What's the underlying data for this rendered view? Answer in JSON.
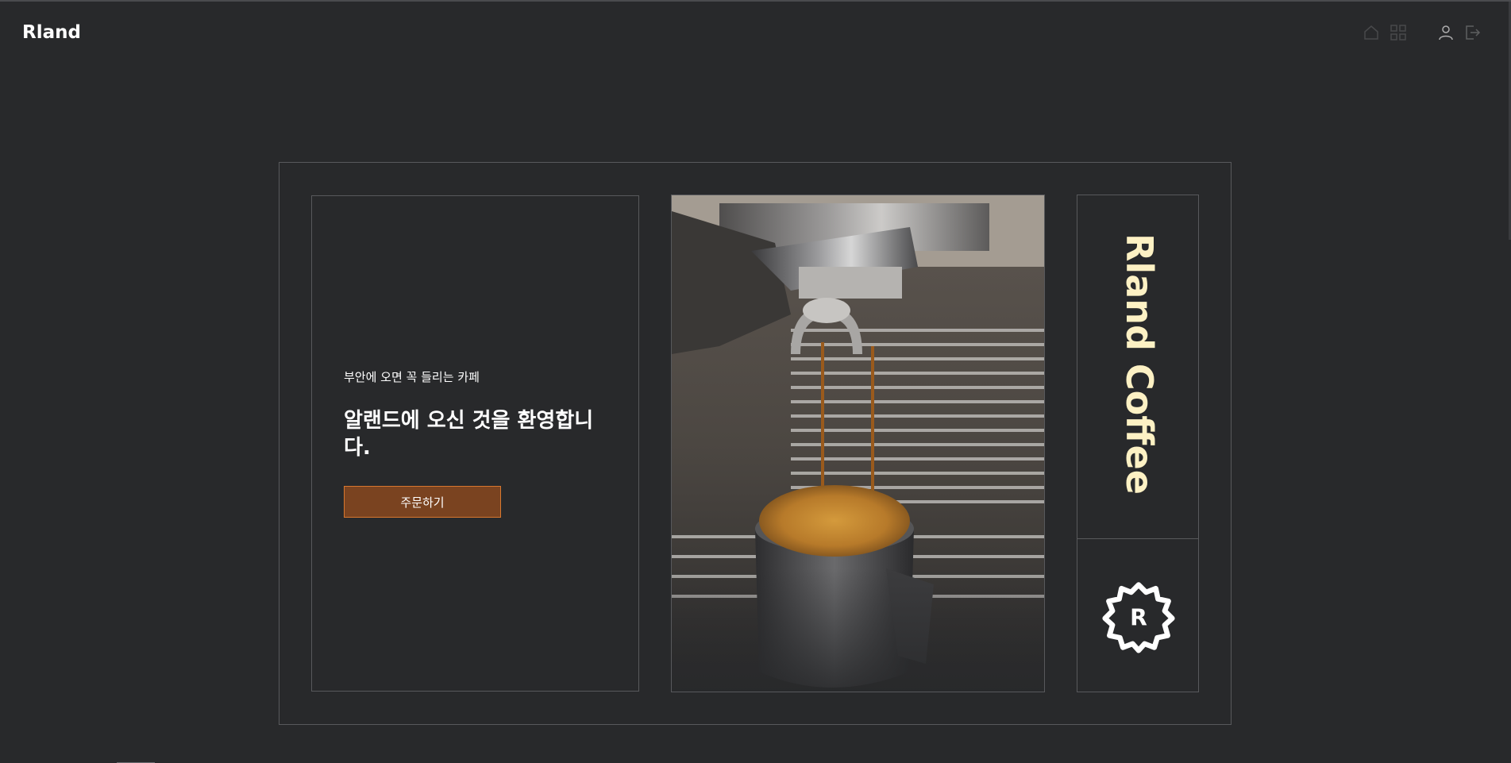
{
  "header": {
    "logo": "Rland",
    "icons": [
      "home-icon",
      "grid-icon",
      "user-icon",
      "logout-icon"
    ]
  },
  "hero": {
    "subtitle": "부안에 오면 꼭 들리는 카페",
    "headline": "알랜드에 오신 것을 환영합니다.",
    "order_button": "주문하기",
    "photo_alt": "espresso pouring into a steel pitcher",
    "brand_vertical": "Rland Coffee",
    "badge_letter": "R"
  },
  "colors": {
    "background": "#28292b",
    "accent_button": "#7a4320",
    "accent_border": "#d7772f",
    "brand_text": "#fdf1c4"
  }
}
